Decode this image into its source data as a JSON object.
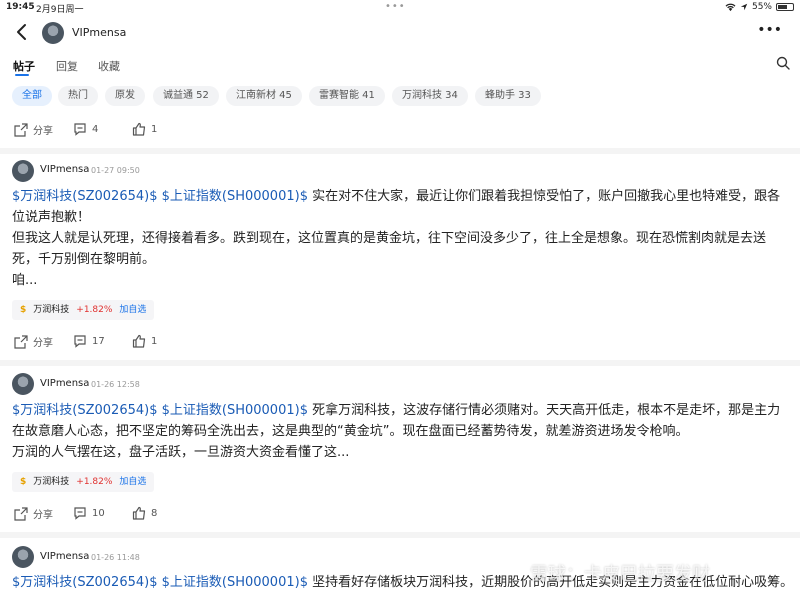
{
  "statusbar": {
    "time": "19:45",
    "date": "2月9日周一",
    "battery": "55%",
    "battery_level": 0.55
  },
  "header": {
    "username": "VIPmensa"
  },
  "tabs": [
    "帖子",
    "回复",
    "收藏"
  ],
  "filters": [
    "全部",
    "热门",
    "原发",
    "诚益通 52",
    "江南新材 45",
    "雷赛智能 41",
    "万润科技 34",
    "蜂助手 33"
  ],
  "top_actions": {
    "share": "分享",
    "comments": "4",
    "likes": "1"
  },
  "posts": [
    {
      "author": "VIPmensa",
      "time": "01-27 09:50",
      "link1": "$万润科技(SZ002654)$",
      "link2": "$上证指数(SH000001)$",
      "text1": "实在对不住大家，最近让你们跟着我担惊受怕了，账户回撤我心里也特难受，跟各位说声抱歉！",
      "text2": "但我这人就是认死理，还得接着看多。跌到现在，这位置真的是黄金坑，往下空间没多少了，往上全是想象。现在恐慌割肉就是去送死，千万别倒在黎明前。",
      "text3": "咱...",
      "stock": {
        "name": "万润科技",
        "change": "+1.82%",
        "add": "加自选"
      },
      "share": "分享",
      "comments": "17",
      "likes": "1"
    },
    {
      "author": "VIPmensa",
      "time": "01-26 12:58",
      "link1": "$万润科技(SZ002654)$",
      "link2": "$上证指数(SH000001)$",
      "text1": "死拿万润科技，这波存储行情必须赌对。天天高开低走，根本不是走坏，那是主力在故意磨人心态，把不坚定的筹码全洗出去，这是典型的“黄金坑”。现在盘面已经蓄势待发，就差游资进场发令枪响。",
      "text2": "万润的人气摆在这，盘子活跃，一旦游资大资金看懂了这...",
      "stock": {
        "name": "万润科技",
        "change": "+1.82%",
        "add": "加自选"
      },
      "share": "分享",
      "comments": "10",
      "likes": "8"
    },
    {
      "author": "VIPmensa",
      "time": "01-26 11:48",
      "link1": "$万润科技(SZ002654)$",
      "link2": "$上证指数(SH000001)$",
      "text1": "坚持看好存储板块万润科技，近期股价的高开低走实则是主力资金在低位耐心吸筹。"
    }
  ],
  "watermark": "雪球：卡皮巴拉要发财"
}
